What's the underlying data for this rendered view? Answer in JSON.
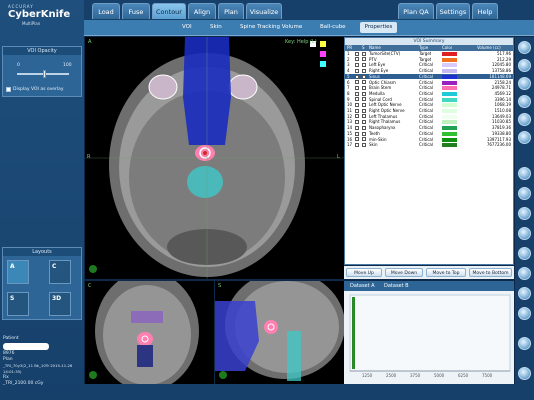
{
  "app": {
    "accuray": "ACCURAY",
    "name": "CyberKnife",
    "sub": "MultiPlan"
  },
  "tabs": [
    "Load",
    "Fuse",
    "Contour",
    "Align",
    "Plan",
    "Visualize",
    "Plan QA",
    "Settings",
    "Help"
  ],
  "subtabs": [
    "VOI",
    "Skin",
    "Spine Tracking Volume",
    "Ball-cube"
  ],
  "properties_label": "Properties",
  "voi_opacity": {
    "title": "VOI Opacity",
    "min": "0",
    "max": "100",
    "overlay_label": "Display VOI as overlay"
  },
  "layouts_title": "Layouts",
  "layouts": [
    "A",
    "C",
    "S",
    "3D"
  ],
  "patient": {
    "label": "Patient",
    "id_partial": "8976",
    "plan_label": "Plan",
    "plan_value": "_TRI_70y3(2_11 Bk_10Tr 2015-11-26 14:01:35)",
    "rx_label": "Rx",
    "rx_value": "_TRI_2100.00 cGy"
  },
  "views": {
    "axial_label": "A",
    "axial_side": "R",
    "axial_right": "L",
    "coronal_label": "C",
    "sagittal_label": "S",
    "axial_info": "Key: Help (L)"
  },
  "voi_summary": {
    "title": "VOI Summary",
    "headers": [
      "PR",
      "",
      "S",
      "Name",
      "Type",
      "Color",
      "Volume (cc)"
    ],
    "rows": [
      {
        "n": "1",
        "name": "TumorSite(CTV)",
        "type": "Target",
        "color": "#e02020",
        "vol": "517.96"
      },
      {
        "n": "2",
        "name": "PTV",
        "type": "Target",
        "color": "#f07020",
        "vol": "212.29"
      },
      {
        "n": "3",
        "name": "Left Eye",
        "type": "Critical",
        "color": "#d9c9ff",
        "vol": "12045.80"
      },
      {
        "n": "4",
        "name": "Right Eye",
        "type": "Critical",
        "color": "#c8b8f0",
        "vol": "13758.86"
      },
      {
        "n": "5",
        "name": "Sinus",
        "type": "Critical",
        "color": "#2030d0",
        "vol": "181148.69"
      },
      {
        "n": "6",
        "name": "Optic Chiasm",
        "type": "Critical",
        "color": "#9a20c0",
        "vol": "2158.24"
      },
      {
        "n": "7",
        "name": "Brain Stem",
        "type": "Critical",
        "color": "#ff70b0",
        "vol": "24978.71"
      },
      {
        "n": "8",
        "name": "Medulla",
        "type": "Critical",
        "color": "#20c8d8",
        "vol": "4569.12"
      },
      {
        "n": "9",
        "name": "Spinal Cord",
        "type": "Critical",
        "color": "#40d8c0",
        "vol": "3396.14"
      },
      {
        "n": "10",
        "name": "Left Optic Nerve",
        "type": "Critical",
        "color": "#d0ffd0",
        "vol": "1068.19"
      },
      {
        "n": "11",
        "name": "Right Optic Nerve",
        "type": "Critical",
        "color": "#e0ffe0",
        "vol": "1510.08"
      },
      {
        "n": "12",
        "name": "Left Thalamus",
        "type": "Critical",
        "color": "#f0fff0",
        "vol": "13649.03"
      },
      {
        "n": "13",
        "name": "Right Thalamus",
        "type": "Critical",
        "color": "#c0f0c0",
        "vol": "11030.85"
      },
      {
        "n": "14",
        "name": "Nasopharynx",
        "type": "Critical",
        "color": "#20a050",
        "vol": "37819.36"
      },
      {
        "n": "15",
        "name": "Teeth",
        "type": "Critical",
        "color": "#30c030",
        "vol": "19338.80"
      },
      {
        "n": "16",
        "name": "min-Skin",
        "type": "Critical",
        "color": "#109010",
        "vol": "1397117.93"
      },
      {
        "n": "17",
        "name": "Skin",
        "type": "Critical",
        "color": "#208020",
        "vol": "7677236.00"
      }
    ]
  },
  "voi_buttons": [
    "Move Up",
    "Move Down",
    "Move to Top",
    "Move to Bottom"
  ],
  "dataset_tabs": [
    "Dataset A",
    "Dataset B"
  ],
  "histogram_ticks": [
    "1250",
    "2500",
    "3750",
    "5000",
    "6250",
    "7500"
  ]
}
